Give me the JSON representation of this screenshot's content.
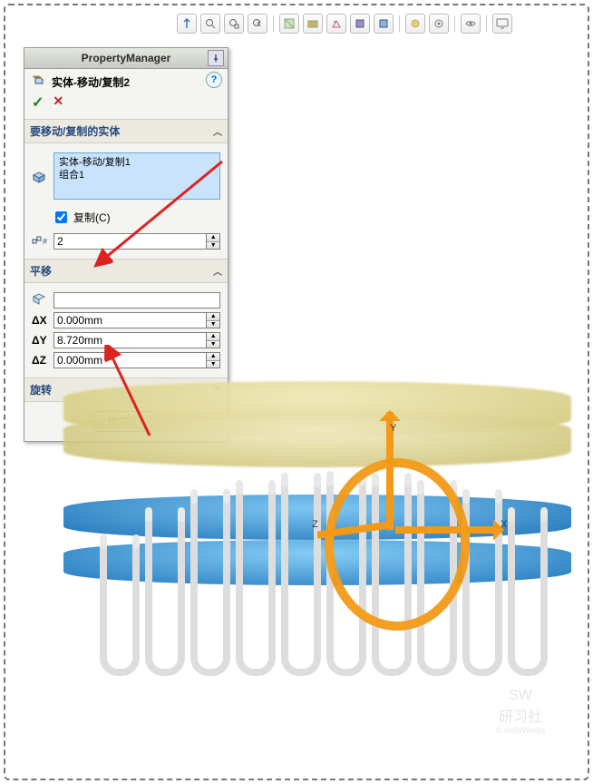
{
  "header": {
    "title": "PropertyManager"
  },
  "feature": {
    "name": "实体-移动/复制2"
  },
  "help": {
    "glyph": "?"
  },
  "confirm": {
    "ok": "✓",
    "cancel": "✕"
  },
  "sections": {
    "bodies": {
      "title": "要移动/复制的实体",
      "items": [
        "实体-移动/复制1",
        "组合1"
      ],
      "copy_label": "复制(C)",
      "copy_checked": true,
      "count_value": "2"
    },
    "translate": {
      "title": "平移",
      "to_value": "",
      "dx_label": "ΔX",
      "dy_label": "ΔY",
      "dz_label": "ΔZ",
      "dx": "0.000mm",
      "dy": "8.720mm",
      "dz": "0.000mm"
    },
    "rotate": {
      "title": "旋转"
    },
    "constrain_btn": "约束(O)"
  },
  "axes": {
    "x": "X",
    "y": "Y",
    "z": "Z"
  },
  "watermark": {
    "top": "SW",
    "main": "研习社",
    "sub": "© SolidWorks"
  },
  "toolbar_icons": [
    "orientation-icon",
    "zoom-fit-icon",
    "zoom-area-icon",
    "prev-view-icon",
    "section-icon",
    "display-style-icon",
    "scene-icon",
    "hide-show-icon",
    "edit-appearance-icon",
    "appearance-icon",
    "setting-icon",
    "view-icon",
    "display-icon"
  ]
}
